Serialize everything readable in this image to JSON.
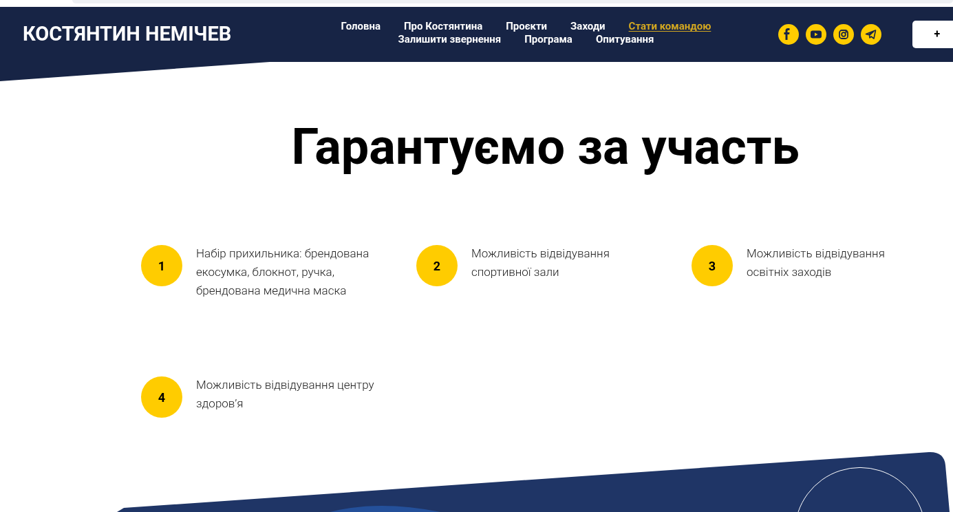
{
  "header": {
    "logo": "КОСТЯНТИН НЕМІЧЕВ",
    "nav_rows": [
      [
        {
          "label": "Головна",
          "selected": false
        },
        {
          "label": "Про Костянтина",
          "selected": false
        },
        {
          "label": "Проєкти",
          "selected": false
        },
        {
          "label": "Заходи",
          "selected": false
        },
        {
          "label": "Стати командою",
          "selected": true
        }
      ],
      [
        {
          "label": "Залишити звернення",
          "selected": false
        },
        {
          "label": "Програма",
          "selected": false
        },
        {
          "label": "Опитування",
          "selected": false
        }
      ]
    ],
    "socials": [
      {
        "kind": "facebook"
      },
      {
        "kind": "youtube"
      },
      {
        "kind": "instagram"
      },
      {
        "kind": "telegram"
      }
    ],
    "button": "+"
  },
  "heading": "Гарантуємо за участь",
  "benefits": [
    {
      "number": "1",
      "text": "Набір прихильника: брендована екосумка, блокнот, ручка, брендована медична маска"
    },
    {
      "number": "2",
      "text": "Можливість відвідування спортивної зали"
    },
    {
      "number": "3",
      "text": "Можливість відвідування освітніх заходів"
    },
    {
      "number": "4",
      "text": "Можливість відвідування центру здоров’я"
    }
  ]
}
